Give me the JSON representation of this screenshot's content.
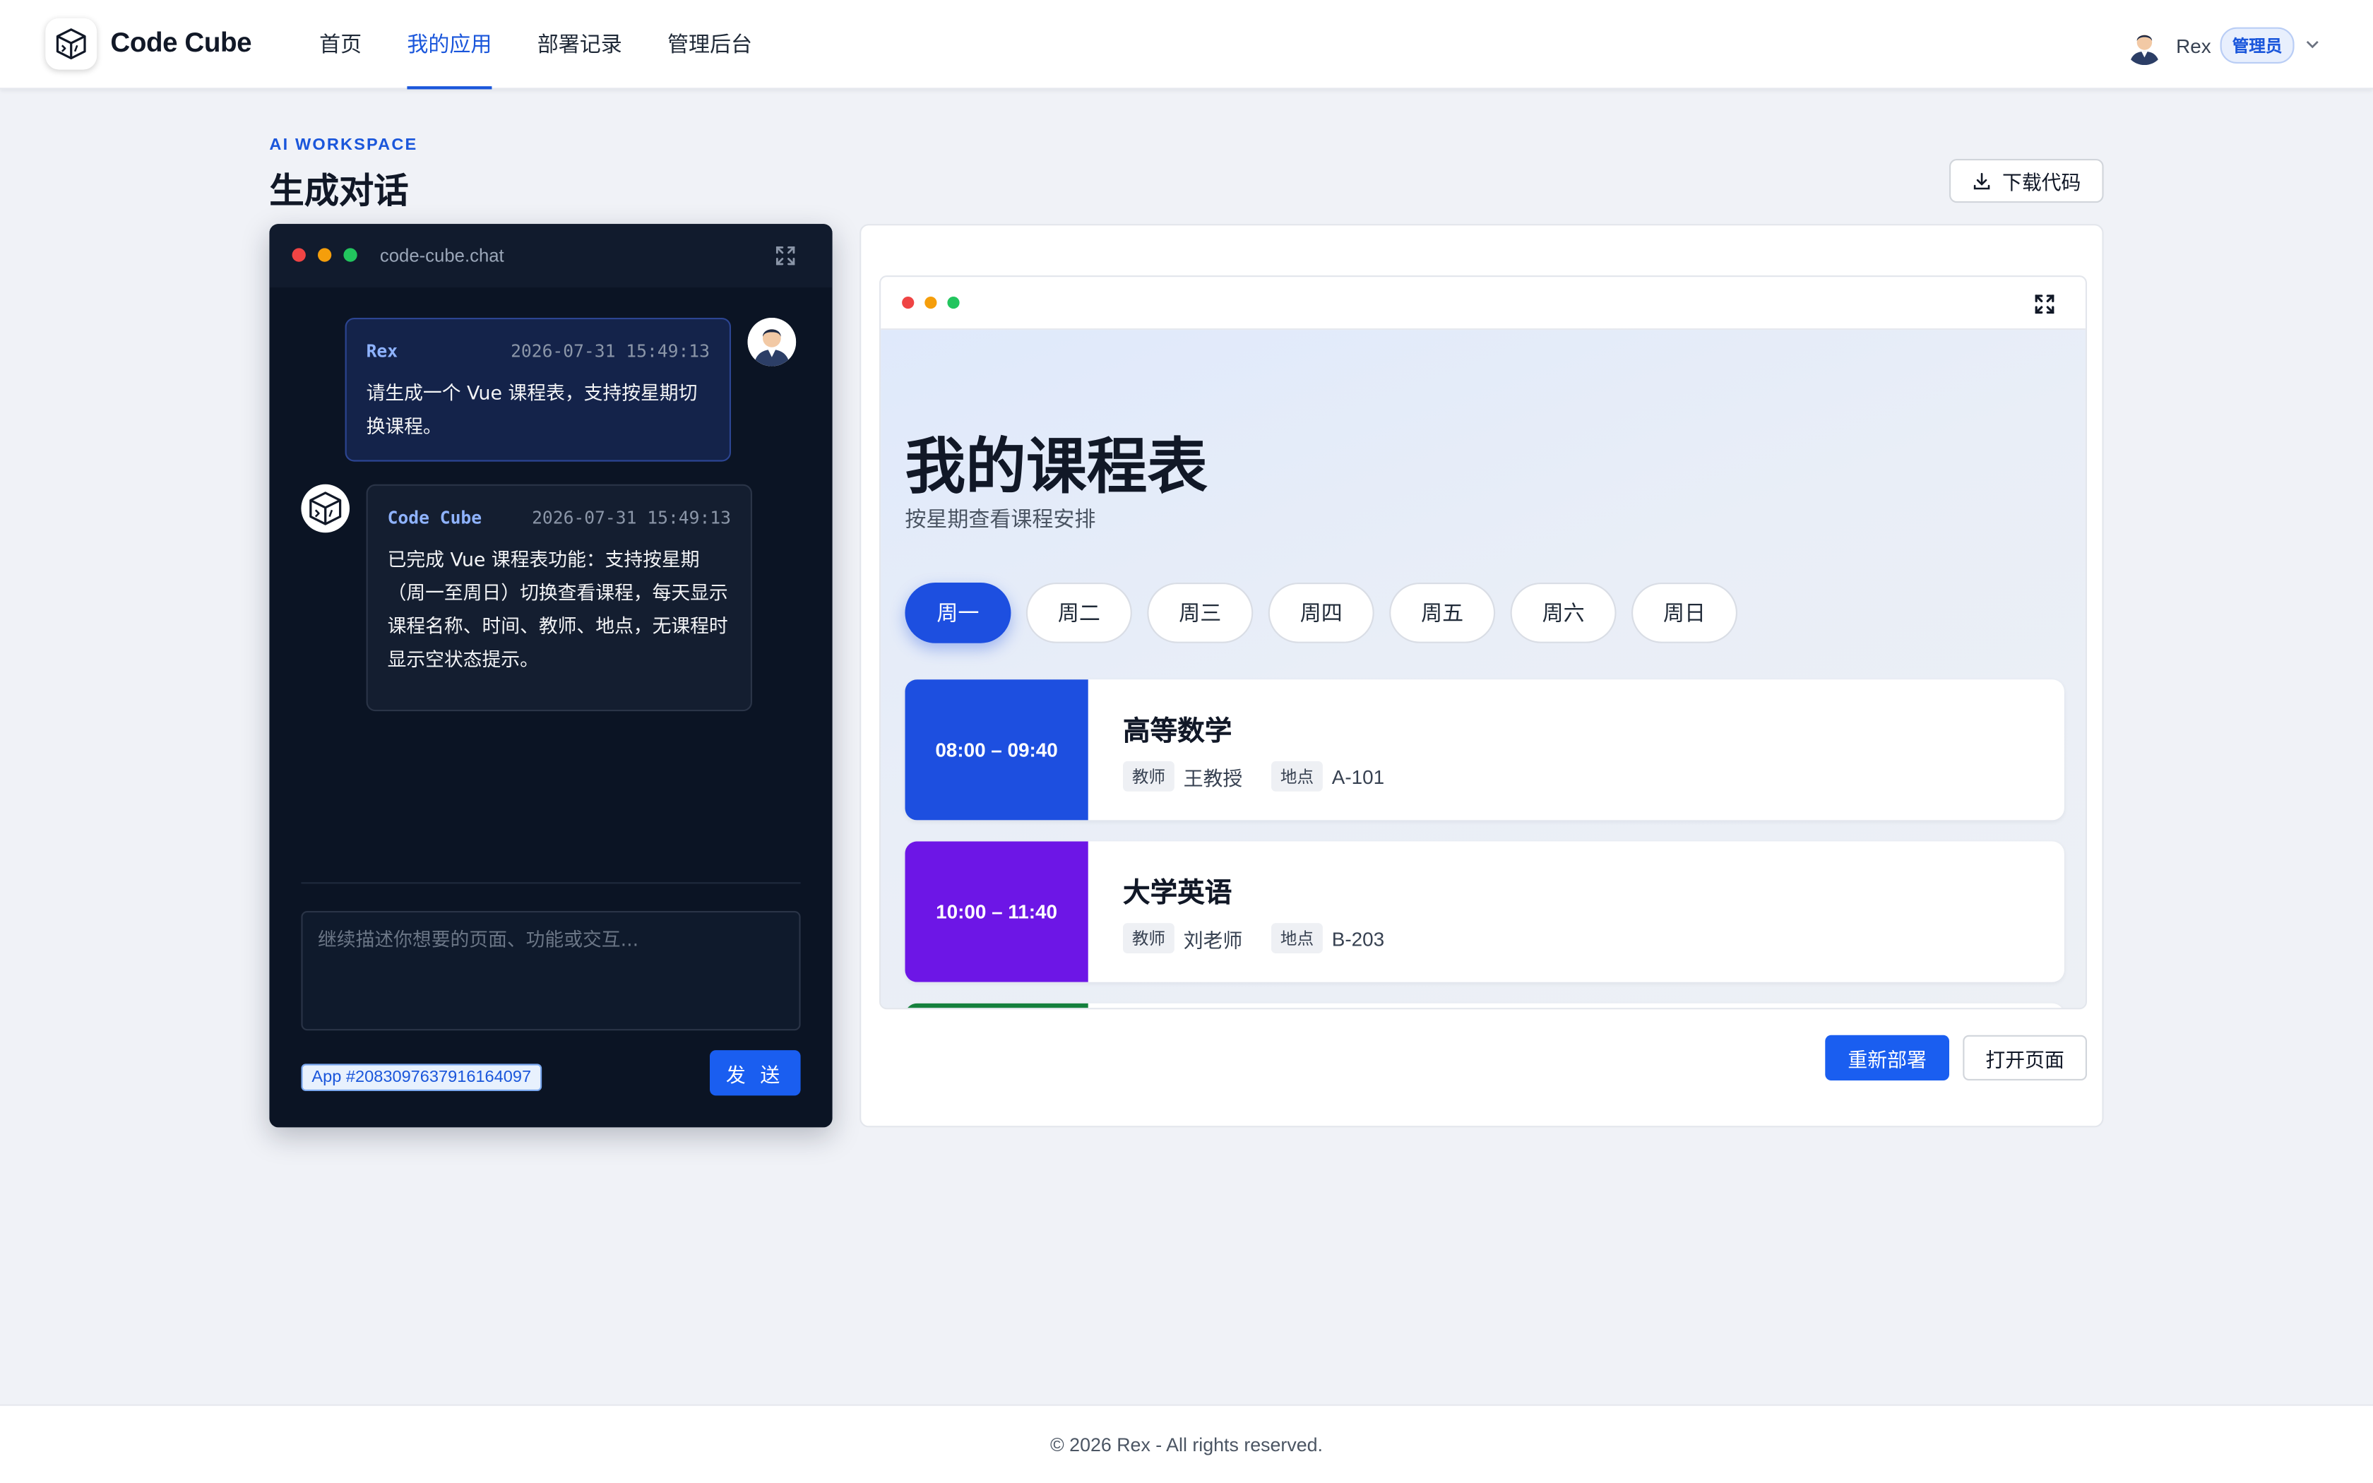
{
  "app": {
    "brand": "Code Cube"
  },
  "nav": {
    "items": [
      {
        "label": "首页",
        "active": false
      },
      {
        "label": "我的应用",
        "active": true
      },
      {
        "label": "部署记录",
        "active": false
      },
      {
        "label": "管理后台",
        "active": false
      }
    ]
  },
  "user": {
    "name": "Rex",
    "role": "管理员"
  },
  "page": {
    "eyebrow": "AI WORKSPACE",
    "title": "生成对话",
    "download_label": "下载代码"
  },
  "chat": {
    "host": "code-cube.chat",
    "messages": [
      {
        "sender": "Rex",
        "time": "2026-07-31 15:49:13",
        "text": "请生成一个 Vue 课程表，支持按星期切换课程。"
      },
      {
        "sender": "Code Cube",
        "time": "2026-07-31 15:49:13",
        "text": "已完成 Vue 课程表功能：支持按星期（周一至周日）切换查看课程，每天显示课程名称、时间、教师、地点，无课程时显示空状态提示。"
      }
    ],
    "input_placeholder": "继续描述你想要的页面、功能或交互...",
    "app_id": "App #2083097637916164097",
    "send_label": "发 送"
  },
  "preview": {
    "title": "我的课程表",
    "subtitle": "按星期查看课程安排",
    "days": [
      "周一",
      "周二",
      "周三",
      "周四",
      "周五",
      "周六",
      "周日"
    ],
    "active_day": "周一",
    "courses": [
      {
        "time": "08:00 – 09:40",
        "name": "高等数学",
        "teacher_tag": "教师",
        "teacher": "王教授",
        "location_tag": "地点",
        "location": "A-101",
        "color": "#1d4fe0"
      },
      {
        "time": "10:00 – 11:40",
        "name": "大学英语",
        "teacher_tag": "教师",
        "teacher": "刘老师",
        "location_tag": "地点",
        "location": "B-203",
        "color": "#6d16e6"
      },
      {
        "time": "",
        "name": "",
        "teacher_tag": "",
        "teacher": "",
        "location_tag": "",
        "location": "",
        "color": "#15803d"
      }
    ],
    "redeploy_label": "重新部署",
    "open_label": "打开页面"
  },
  "footer": {
    "text": "© 2026 Rex - All rights reserved."
  },
  "colors": {
    "accent": "#1a56db",
    "chat_bg": "#0b1424",
    "page_bg": "#f0f2f7"
  }
}
